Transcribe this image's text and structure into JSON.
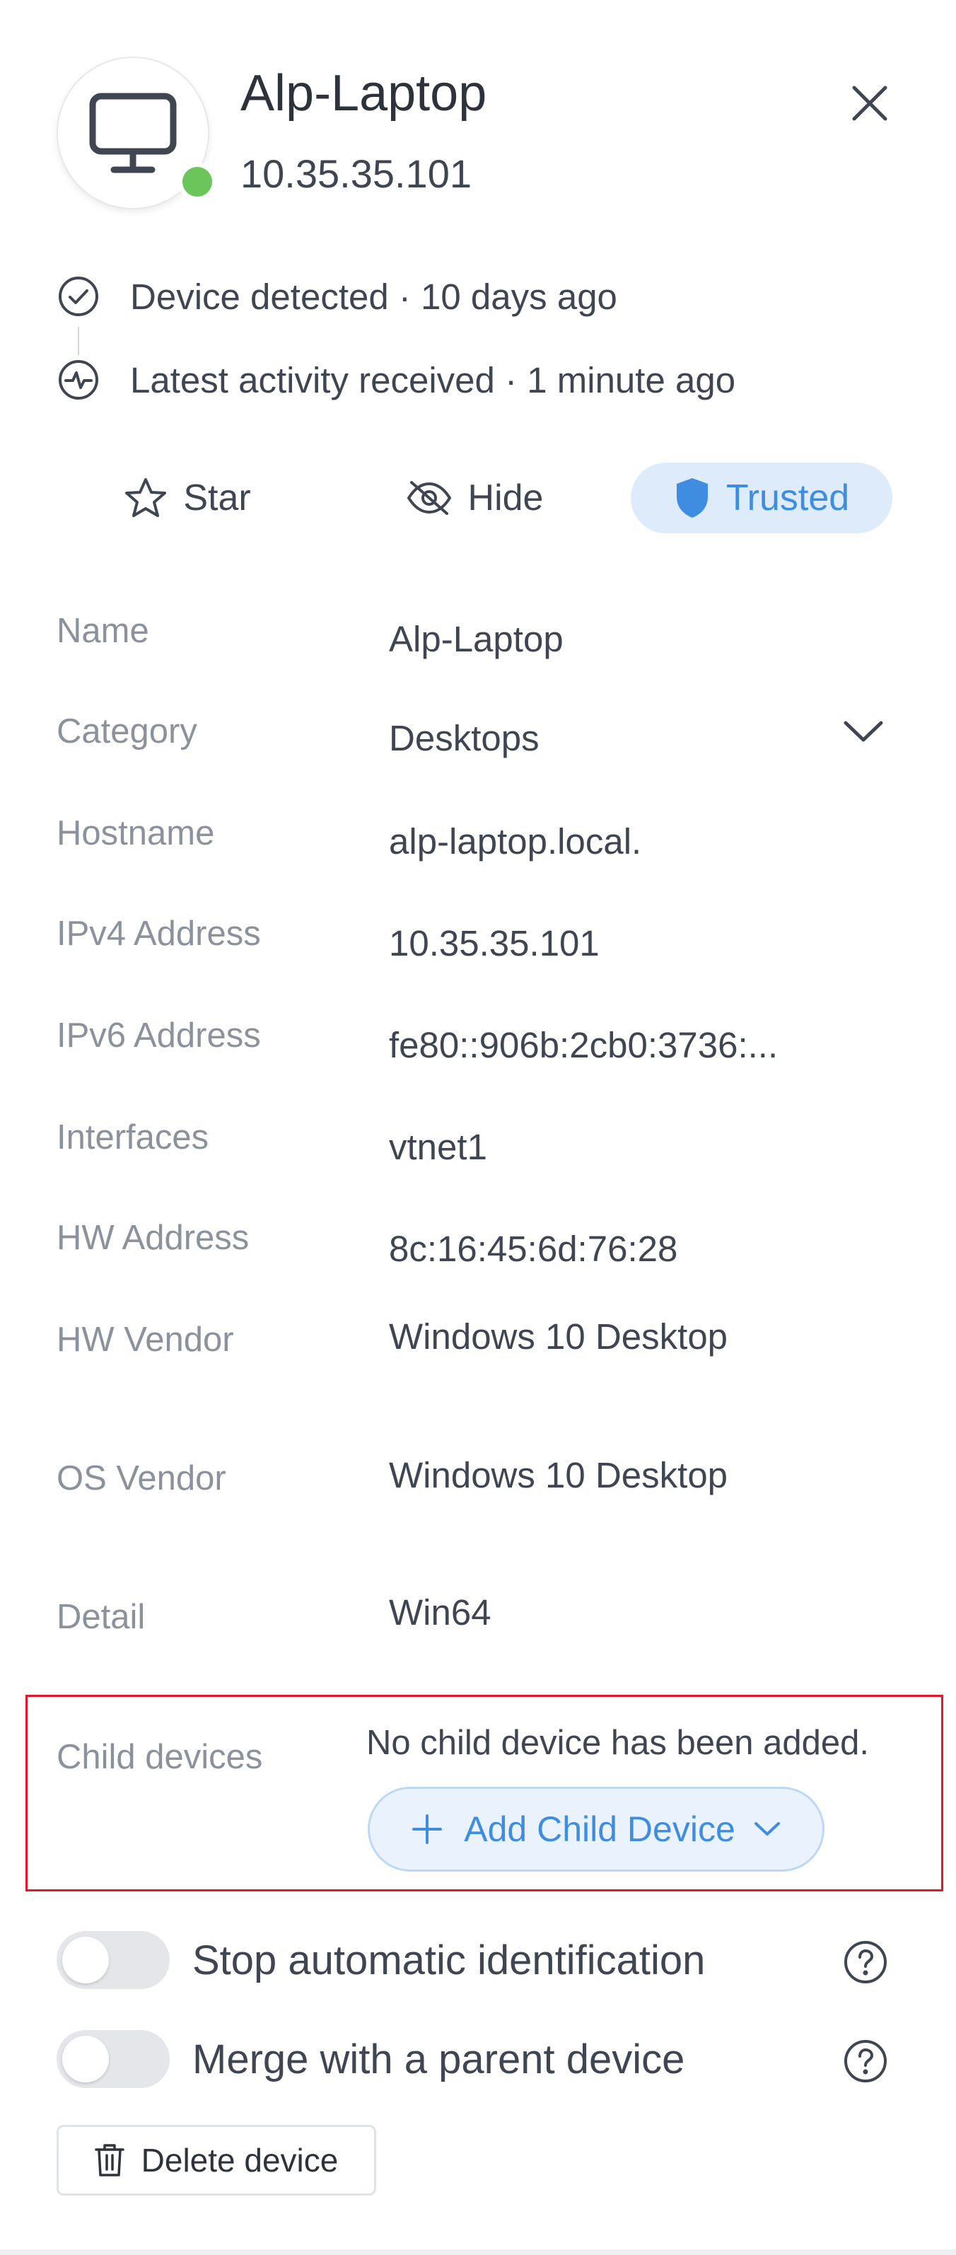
{
  "device": {
    "name": "Alp-Laptop",
    "ip": "10.35.35.101",
    "status_color": "#6cc55a",
    "icon": "monitor-icon"
  },
  "timeline": [
    {
      "icon": "check-circle-icon",
      "text": "Device detected · 10 days ago"
    },
    {
      "icon": "activity-icon",
      "text": "Latest activity received · 1 minute ago"
    }
  ],
  "actions": {
    "star": "Star",
    "hide": "Hide",
    "trusted": "Trusted",
    "accent_color": "#3f8de0"
  },
  "fields": [
    {
      "label": "Name",
      "value": "Alp-Laptop"
    },
    {
      "label": "Category",
      "value": "Desktops"
    },
    {
      "label": "Hostname",
      "value": "alp-laptop.local."
    },
    {
      "label": "IPv4 Address",
      "value": "10.35.35.101"
    },
    {
      "label": "IPv6 Address",
      "value": "fe80::906b:2cb0:3736:..."
    },
    {
      "label": "Interfaces",
      "value": "vtnet1"
    },
    {
      "label": "HW Address",
      "value": "8c:16:45:6d:76:28"
    },
    {
      "label": "HW Vendor",
      "value": "Windows 10 Desktop"
    },
    {
      "label": "OS Vendor",
      "value": "Windows 10 Desktop"
    },
    {
      "label": "Detail",
      "value": "Win64"
    }
  ],
  "child_devices": {
    "label": "Child devices",
    "empty_text": "No child device has been added.",
    "add_button": "Add Child Device",
    "highlight_color": "#e0182d"
  },
  "toggles": [
    {
      "label": "Stop automatic identification",
      "on": false
    },
    {
      "label": "Merge with a parent device",
      "on": false
    }
  ],
  "delete_button": "Delete device"
}
